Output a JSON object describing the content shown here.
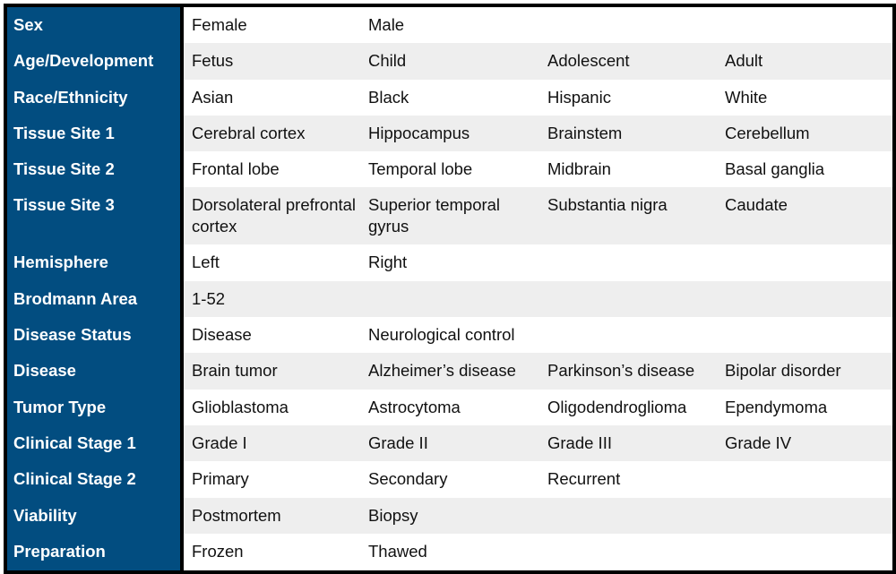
{
  "table": {
    "rows": [
      {
        "label": "Sex",
        "values": [
          "Female",
          "Male",
          "",
          ""
        ]
      },
      {
        "label": "Age/Development",
        "values": [
          "Fetus",
          "Child",
          "Adolescent",
          "Adult"
        ]
      },
      {
        "label": "Race/Ethnicity",
        "values": [
          "Asian",
          "Black",
          "Hispanic",
          "White"
        ]
      },
      {
        "label": "Tissue Site 1",
        "values": [
          "Cerebral cortex",
          "Hippocampus",
          "Brainstem",
          "Cerebellum"
        ]
      },
      {
        "label": "Tissue Site 2",
        "values": [
          "Frontal lobe",
          "Temporal lobe",
          "Midbrain",
          "Basal ganglia"
        ]
      },
      {
        "label": "Tissue Site 3",
        "values": [
          "Dorsolateral prefrontal cortex",
          "Superior temporal gyrus",
          "Substantia nigra",
          "Caudate"
        ]
      },
      {
        "label": "Hemisphere",
        "values": [
          "Left",
          "Right",
          "",
          ""
        ]
      },
      {
        "label": "Brodmann Area",
        "values": [
          "1-52",
          "",
          "",
          ""
        ]
      },
      {
        "label": "Disease Status",
        "values": [
          "Disease",
          "Neurological control",
          "",
          ""
        ]
      },
      {
        "label": "Disease",
        "values": [
          "Brain tumor",
          "Alzheimer’s disease",
          "Parkinson’s disease",
          "Bipolar disorder"
        ]
      },
      {
        "label": "Tumor Type",
        "values": [
          "Glioblastoma",
          "Astrocytoma",
          "Oligodendroglioma",
          "Ependymoma"
        ]
      },
      {
        "label": "Clinical Stage 1",
        "values": [
          "Grade I",
          "Grade II",
          "Grade III",
          "Grade IV"
        ]
      },
      {
        "label": "Clinical Stage 2",
        "values": [
          "Primary",
          "Secondary",
          "Recurrent",
          ""
        ]
      },
      {
        "label": "Viability",
        "values": [
          "Postmortem",
          "Biopsy",
          "",
          ""
        ]
      },
      {
        "label": "Preparation",
        "values": [
          "Frozen",
          "Thawed",
          "",
          ""
        ]
      }
    ]
  },
  "colors": {
    "header_bg": "#024d80",
    "header_text": "#ffffff",
    "band_bg": "#eeeeee",
    "border": "#000000"
  }
}
